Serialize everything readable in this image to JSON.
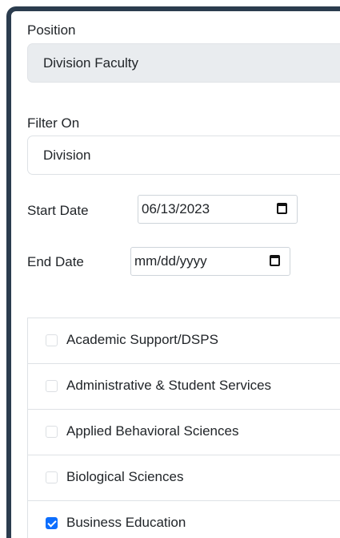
{
  "position": {
    "label": "Position",
    "value": "Division Faculty"
  },
  "filter": {
    "label": "Filter On",
    "value": "Division"
  },
  "start_date": {
    "label": "Start Date",
    "value": "06/13/2023"
  },
  "end_date": {
    "label": "End Date",
    "placeholder": "mm/dd/yyyy"
  },
  "divisions": [
    {
      "label": "Academic Support/DSPS",
      "checked": false
    },
    {
      "label": "Administrative & Student Services",
      "checked": false
    },
    {
      "label": "Applied Behavioral Sciences",
      "checked": false
    },
    {
      "label": "Biological Sciences",
      "checked": false
    },
    {
      "label": "Business Education",
      "checked": true
    }
  ],
  "colors": {
    "frame": "#2b3c4e",
    "checkbox_checked": "#0d6efd",
    "disabled_field": "#e9ecef"
  }
}
